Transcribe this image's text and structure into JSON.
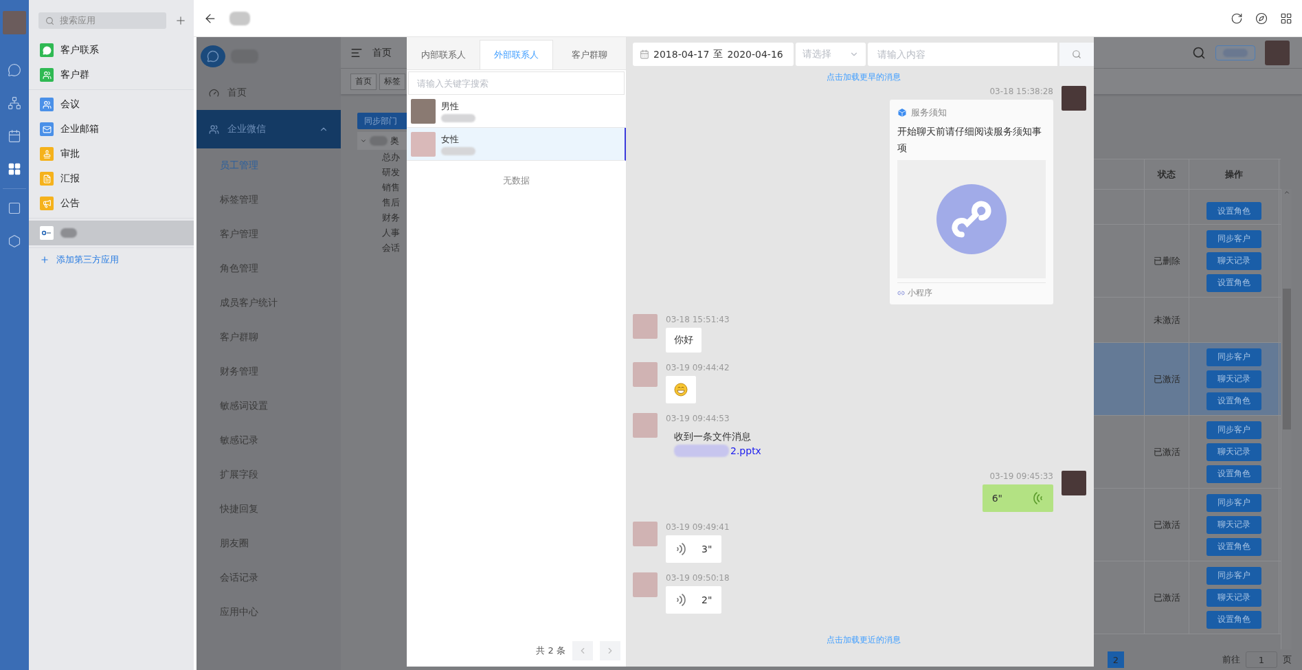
{
  "rail": {
    "items": [
      {
        "kind": "chat",
        "selected": false
      },
      {
        "kind": "org",
        "selected": false
      },
      {
        "kind": "calendar",
        "selected": false
      },
      {
        "kind": "apps",
        "selected": true
      },
      {
        "kind": "doc",
        "selected": false
      },
      {
        "kind": "hexagon",
        "selected": false
      }
    ]
  },
  "app_list": {
    "search_placeholder": "搜索应用",
    "groups": [
      [
        {
          "label": "客户联系",
          "kind": "chat",
          "color": "#2fb953",
          "selected": false
        },
        {
          "label": "客户群",
          "kind": "group",
          "color": "#2fb953",
          "selected": false
        }
      ],
      [
        {
          "label": "会议",
          "kind": "meeting",
          "color": "#4a90e8",
          "selected": false
        },
        {
          "label": "企业邮箱",
          "kind": "mail",
          "color": "#4a90e8",
          "selected": false
        },
        {
          "label": "审批",
          "kind": "stamp",
          "color": "#f5b21c",
          "selected": false
        },
        {
          "label": "汇报",
          "kind": "report",
          "color": "#f5b21c",
          "selected": false
        },
        {
          "label": "公告",
          "kind": "notice",
          "color": "#f5b21c",
          "selected": false
        }
      ],
      [
        {
          "kind": "third_party",
          "color": "#ffffff",
          "selected": true
        }
      ]
    ],
    "add_label": "添加第三方应用"
  },
  "web_sidebar": {
    "items": [
      {
        "label": "首页",
        "kind": "dashboard",
        "selected": false
      },
      {
        "label": "企业微信",
        "kind": "wechat",
        "expanded": true,
        "children": [
          {
            "label": "员工管理",
            "selected": true
          },
          {
            "label": "标签管理",
            "selected": false
          },
          {
            "label": "客户管理",
            "selected": false
          },
          {
            "label": "角色管理",
            "selected": false
          },
          {
            "label": "成员客户统计",
            "selected": false
          },
          {
            "label": "客户群聊",
            "selected": false
          },
          {
            "label": "财务管理",
            "selected": false
          },
          {
            "label": "敏感词设置",
            "selected": false
          },
          {
            "label": "敏感记录",
            "selected": false
          },
          {
            "label": "扩展字段",
            "selected": false
          },
          {
            "label": "快捷回复",
            "selected": false
          },
          {
            "label": "朋友圈",
            "selected": false
          },
          {
            "label": "会话记录",
            "selected": false
          },
          {
            "label": "应用中心",
            "selected": false
          }
        ]
      }
    ]
  },
  "web_header": {
    "nav_label": "首页",
    "tags": [
      "首页",
      "标签"
    ]
  },
  "dept_tree": {
    "sync_button": "同步部门",
    "root": {
      "label": "奥",
      "expanded": true,
      "children": [
        {
          "label": "总办"
        },
        {
          "label": "研发"
        },
        {
          "label": "销售"
        },
        {
          "label": "售后"
        },
        {
          "label": "财务"
        },
        {
          "label": "人事"
        },
        {
          "label": "会话"
        }
      ]
    }
  },
  "table": {
    "columns": [
      "状态",
      "操作"
    ],
    "rows": [
      {
        "actions": [
          "设置角色"
        ],
        "selected": false
      },
      {
        "status": "已删除",
        "actions": [
          "同步客户",
          "聊天记录",
          "设置角色"
        ],
        "selected": false
      },
      {
        "status": "未激活",
        "actions": [],
        "selected": false
      },
      {
        "status": "已激活",
        "actions": [
          "同步客户",
          "聊天记录",
          "设置角色"
        ],
        "selected": true
      },
      {
        "status": "已激活",
        "actions": [
          "同步客户",
          "聊天记录",
          "设置角色"
        ],
        "selected": false
      },
      {
        "status": "已激活",
        "actions": [
          "同步客户",
          "聊天记录",
          "设置角色"
        ],
        "selected": false
      },
      {
        "status": "已激活",
        "actions": [
          "同步客户",
          "聊天记录",
          "设置角色"
        ],
        "selected": false
      }
    ]
  },
  "pagination": {
    "current": "2",
    "goto_label": "前往",
    "page_value": "1",
    "page_suffix": "页"
  },
  "modal": {
    "tabs": [
      {
        "label": "内部联系人",
        "selected": false
      },
      {
        "label": "外部联系人",
        "selected": true
      },
      {
        "label": "客户群聊",
        "selected": false
      }
    ],
    "search_placeholder": "请输入关键字搜索",
    "contacts": [
      {
        "name": "男性",
        "selected": false
      },
      {
        "name": "女性",
        "selected": true
      }
    ],
    "empty_text": "无数据",
    "total": "共 2 条",
    "chat": {
      "date_start": "2018-04-17",
      "date_sep": "至",
      "date_end": "2020-04-16",
      "select_placeholder": "请选择",
      "input_placeholder": "请输入内容",
      "load_earlier": "点击加载更早的消息",
      "load_later": "点击加载更近的消息",
      "messages": [
        {
          "outgoing": true,
          "time": "03-18 15:38:28",
          "kind": "mini_program",
          "title": "服务须知",
          "text": "开始聊天前请仔细阅读服务须知事项",
          "footer": "小程序"
        },
        {
          "outgoing": false,
          "time": "03-18 15:51:43",
          "kind": "text",
          "text": "你好"
        },
        {
          "outgoing": false,
          "time": "03-19 09:44:42",
          "kind": "emoji"
        },
        {
          "outgoing": false,
          "time": "03-19 09:44:53",
          "kind": "file",
          "text": "收到一条文件消息",
          "file": "2.pptx"
        },
        {
          "outgoing": true,
          "time": "03-19 09:45:33",
          "kind": "voice",
          "duration": "6\""
        },
        {
          "outgoing": false,
          "time": "03-19 09:49:41",
          "kind": "voice",
          "duration": "3\""
        },
        {
          "outgoing": false,
          "time": "03-19 09:50:18",
          "kind": "voice",
          "duration": "2\""
        }
      ]
    }
  }
}
